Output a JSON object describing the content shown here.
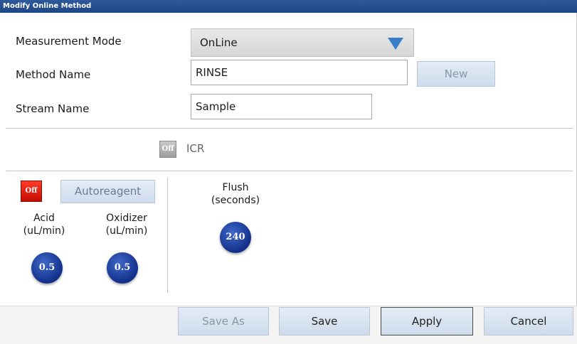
{
  "window": {
    "title": "Modify Online Method"
  },
  "measurement_mode": {
    "label": "Measurement Mode",
    "value": "OnLine"
  },
  "method_name": {
    "label": "Method Name",
    "value": "RINSE",
    "new_button": "New"
  },
  "stream_name": {
    "label": "Stream Name",
    "value": "Sample"
  },
  "icr": {
    "toggle_label": "Off",
    "label": "ICR"
  },
  "autoreagent": {
    "toggle_label": "Off",
    "button_label": "Autoreagent"
  },
  "acid": {
    "label_line1": "Acid",
    "label_line2": "(uL/min)",
    "value": "0.5"
  },
  "oxidizer": {
    "label_line1": "Oxidizer",
    "label_line2": "(uL/min)",
    "value": "0.5"
  },
  "flush": {
    "label_line1": "Flush",
    "label_line2": "(seconds)",
    "value": "240"
  },
  "footer": {
    "save_as": "Save As",
    "save": "Save",
    "apply": "Apply",
    "cancel": "Cancel"
  },
  "colors": {
    "title_bar": "#1f4686",
    "toggle_off_red": "#e01a0a",
    "toggle_off_grey": "#a6a6a6",
    "value_circle": "#1a3a96",
    "dropdown_arrow": "#3a7ec9"
  }
}
